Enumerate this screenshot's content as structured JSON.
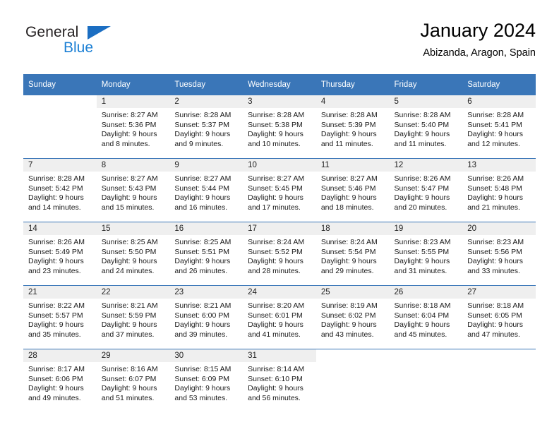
{
  "brand": {
    "name_top": "General",
    "name_bottom": "Blue",
    "accent_dark": "#1b6ec2",
    "accent_light": "#1b7fd4",
    "triangle_icon": "triangle-icon"
  },
  "header": {
    "title": "January 2024",
    "subtitle": "Abizanda, Aragon, Spain"
  },
  "theme": {
    "header_bg": "#3a76b8",
    "daynum_bg": "#efefef",
    "text": "#000000"
  },
  "weekdays": [
    "Sunday",
    "Monday",
    "Tuesday",
    "Wednesday",
    "Thursday",
    "Friday",
    "Saturday"
  ],
  "weeks": [
    [
      {
        "day": "",
        "lines": []
      },
      {
        "day": "1",
        "lines": [
          "Sunrise: 8:27 AM",
          "Sunset: 5:36 PM",
          "Daylight: 9 hours",
          "and 8 minutes."
        ]
      },
      {
        "day": "2",
        "lines": [
          "Sunrise: 8:28 AM",
          "Sunset: 5:37 PM",
          "Daylight: 9 hours",
          "and 9 minutes."
        ]
      },
      {
        "day": "3",
        "lines": [
          "Sunrise: 8:28 AM",
          "Sunset: 5:38 PM",
          "Daylight: 9 hours",
          "and 10 minutes."
        ]
      },
      {
        "day": "4",
        "lines": [
          "Sunrise: 8:28 AM",
          "Sunset: 5:39 PM",
          "Daylight: 9 hours",
          "and 11 minutes."
        ]
      },
      {
        "day": "5",
        "lines": [
          "Sunrise: 8:28 AM",
          "Sunset: 5:40 PM",
          "Daylight: 9 hours",
          "and 11 minutes."
        ]
      },
      {
        "day": "6",
        "lines": [
          "Sunrise: 8:28 AM",
          "Sunset: 5:41 PM",
          "Daylight: 9 hours",
          "and 12 minutes."
        ]
      }
    ],
    [
      {
        "day": "7",
        "lines": [
          "Sunrise: 8:28 AM",
          "Sunset: 5:42 PM",
          "Daylight: 9 hours",
          "and 14 minutes."
        ]
      },
      {
        "day": "8",
        "lines": [
          "Sunrise: 8:27 AM",
          "Sunset: 5:43 PM",
          "Daylight: 9 hours",
          "and 15 minutes."
        ]
      },
      {
        "day": "9",
        "lines": [
          "Sunrise: 8:27 AM",
          "Sunset: 5:44 PM",
          "Daylight: 9 hours",
          "and 16 minutes."
        ]
      },
      {
        "day": "10",
        "lines": [
          "Sunrise: 8:27 AM",
          "Sunset: 5:45 PM",
          "Daylight: 9 hours",
          "and 17 minutes."
        ]
      },
      {
        "day": "11",
        "lines": [
          "Sunrise: 8:27 AM",
          "Sunset: 5:46 PM",
          "Daylight: 9 hours",
          "and 18 minutes."
        ]
      },
      {
        "day": "12",
        "lines": [
          "Sunrise: 8:26 AM",
          "Sunset: 5:47 PM",
          "Daylight: 9 hours",
          "and 20 minutes."
        ]
      },
      {
        "day": "13",
        "lines": [
          "Sunrise: 8:26 AM",
          "Sunset: 5:48 PM",
          "Daylight: 9 hours",
          "and 21 minutes."
        ]
      }
    ],
    [
      {
        "day": "14",
        "lines": [
          "Sunrise: 8:26 AM",
          "Sunset: 5:49 PM",
          "Daylight: 9 hours",
          "and 23 minutes."
        ]
      },
      {
        "day": "15",
        "lines": [
          "Sunrise: 8:25 AM",
          "Sunset: 5:50 PM",
          "Daylight: 9 hours",
          "and 24 minutes."
        ]
      },
      {
        "day": "16",
        "lines": [
          "Sunrise: 8:25 AM",
          "Sunset: 5:51 PM",
          "Daylight: 9 hours",
          "and 26 minutes."
        ]
      },
      {
        "day": "17",
        "lines": [
          "Sunrise: 8:24 AM",
          "Sunset: 5:52 PM",
          "Daylight: 9 hours",
          "and 28 minutes."
        ]
      },
      {
        "day": "18",
        "lines": [
          "Sunrise: 8:24 AM",
          "Sunset: 5:54 PM",
          "Daylight: 9 hours",
          "and 29 minutes."
        ]
      },
      {
        "day": "19",
        "lines": [
          "Sunrise: 8:23 AM",
          "Sunset: 5:55 PM",
          "Daylight: 9 hours",
          "and 31 minutes."
        ]
      },
      {
        "day": "20",
        "lines": [
          "Sunrise: 8:23 AM",
          "Sunset: 5:56 PM",
          "Daylight: 9 hours",
          "and 33 minutes."
        ]
      }
    ],
    [
      {
        "day": "21",
        "lines": [
          "Sunrise: 8:22 AM",
          "Sunset: 5:57 PM",
          "Daylight: 9 hours",
          "and 35 minutes."
        ]
      },
      {
        "day": "22",
        "lines": [
          "Sunrise: 8:21 AM",
          "Sunset: 5:59 PM",
          "Daylight: 9 hours",
          "and 37 minutes."
        ]
      },
      {
        "day": "23",
        "lines": [
          "Sunrise: 8:21 AM",
          "Sunset: 6:00 PM",
          "Daylight: 9 hours",
          "and 39 minutes."
        ]
      },
      {
        "day": "24",
        "lines": [
          "Sunrise: 8:20 AM",
          "Sunset: 6:01 PM",
          "Daylight: 9 hours",
          "and 41 minutes."
        ]
      },
      {
        "day": "25",
        "lines": [
          "Sunrise: 8:19 AM",
          "Sunset: 6:02 PM",
          "Daylight: 9 hours",
          "and 43 minutes."
        ]
      },
      {
        "day": "26",
        "lines": [
          "Sunrise: 8:18 AM",
          "Sunset: 6:04 PM",
          "Daylight: 9 hours",
          "and 45 minutes."
        ]
      },
      {
        "day": "27",
        "lines": [
          "Sunrise: 8:18 AM",
          "Sunset: 6:05 PM",
          "Daylight: 9 hours",
          "and 47 minutes."
        ]
      }
    ],
    [
      {
        "day": "28",
        "lines": [
          "Sunrise: 8:17 AM",
          "Sunset: 6:06 PM",
          "Daylight: 9 hours",
          "and 49 minutes."
        ]
      },
      {
        "day": "29",
        "lines": [
          "Sunrise: 8:16 AM",
          "Sunset: 6:07 PM",
          "Daylight: 9 hours",
          "and 51 minutes."
        ]
      },
      {
        "day": "30",
        "lines": [
          "Sunrise: 8:15 AM",
          "Sunset: 6:09 PM",
          "Daylight: 9 hours",
          "and 53 minutes."
        ]
      },
      {
        "day": "31",
        "lines": [
          "Sunrise: 8:14 AM",
          "Sunset: 6:10 PM",
          "Daylight: 9 hours",
          "and 56 minutes."
        ]
      },
      {
        "day": "",
        "lines": []
      },
      {
        "day": "",
        "lines": []
      },
      {
        "day": "",
        "lines": []
      }
    ]
  ]
}
